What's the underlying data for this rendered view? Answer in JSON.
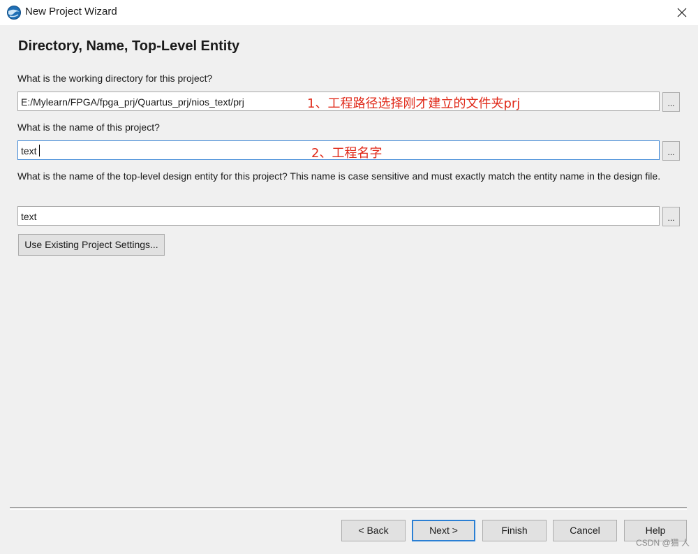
{
  "window": {
    "title": "New Project Wizard",
    "app_icon": "quartus-globe-icon",
    "close_icon": "close-icon"
  },
  "page": {
    "heading": "Directory, Name, Top-Level Entity"
  },
  "directory": {
    "label": "What is the working directory for this project?",
    "value": "E:/Mylearn/FPGA/fpga_prj/Quartus_prj/nios_text/prj",
    "browse_label": "...",
    "annotation": "1、工程路径选择刚才建立的文件夹prj"
  },
  "project_name": {
    "label": "What is the name of this project?",
    "value": "text",
    "browse_label": "...",
    "annotation": "2、工程名字"
  },
  "top_level": {
    "label": "What is the name of the top-level design entity for this project? This name is case sensitive and must exactly match the entity name in the design file.",
    "value": "text",
    "browse_label": "..."
  },
  "use_existing_button": "Use Existing Project Settings...",
  "footer": {
    "back": "< Back",
    "next": "Next >",
    "finish": "Finish",
    "cancel": "Cancel",
    "help": "Help"
  },
  "watermark": "CSDN @猫 人",
  "colors": {
    "annotation": "#e02a1a",
    "focus_border": "#3b86d6",
    "default_button_border": "#2a7fd4"
  }
}
